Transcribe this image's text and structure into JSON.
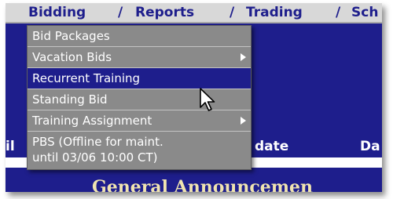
{
  "nav": {
    "bidding": "Bidding",
    "sep1": "/",
    "reports": "Reports",
    "sep2": "/",
    "trading": "Trading",
    "sep3": "/",
    "sch": "Sch"
  },
  "menu": {
    "items": [
      {
        "label": "Bid Packages",
        "has_submenu": false
      },
      {
        "label": "Vacation Bids",
        "has_submenu": true
      },
      {
        "label": "Recurrent Training",
        "has_submenu": false,
        "highlighted": true
      },
      {
        "label": "Standing Bid",
        "has_submenu": false
      },
      {
        "label": "Training Assignment",
        "has_submenu": true
      }
    ],
    "pbs_line1": "PBS (Offline for maint.",
    "pbs_line2": "until 03/06 10:00 CT)"
  },
  "table": {
    "col_left_partial": "il",
    "col_date": "date",
    "col_right_partial": "Da"
  },
  "announcement": "General Announcemen",
  "colors": {
    "page_blue": "#1e1e8c",
    "navbar_gray": "#d8d8d8",
    "menu_gray": "#8a8a8a",
    "highlight": "#1e1e8c"
  },
  "icons": {
    "cursor": "arrow-pointer-icon",
    "submenu": "submenu-arrow-icon"
  }
}
